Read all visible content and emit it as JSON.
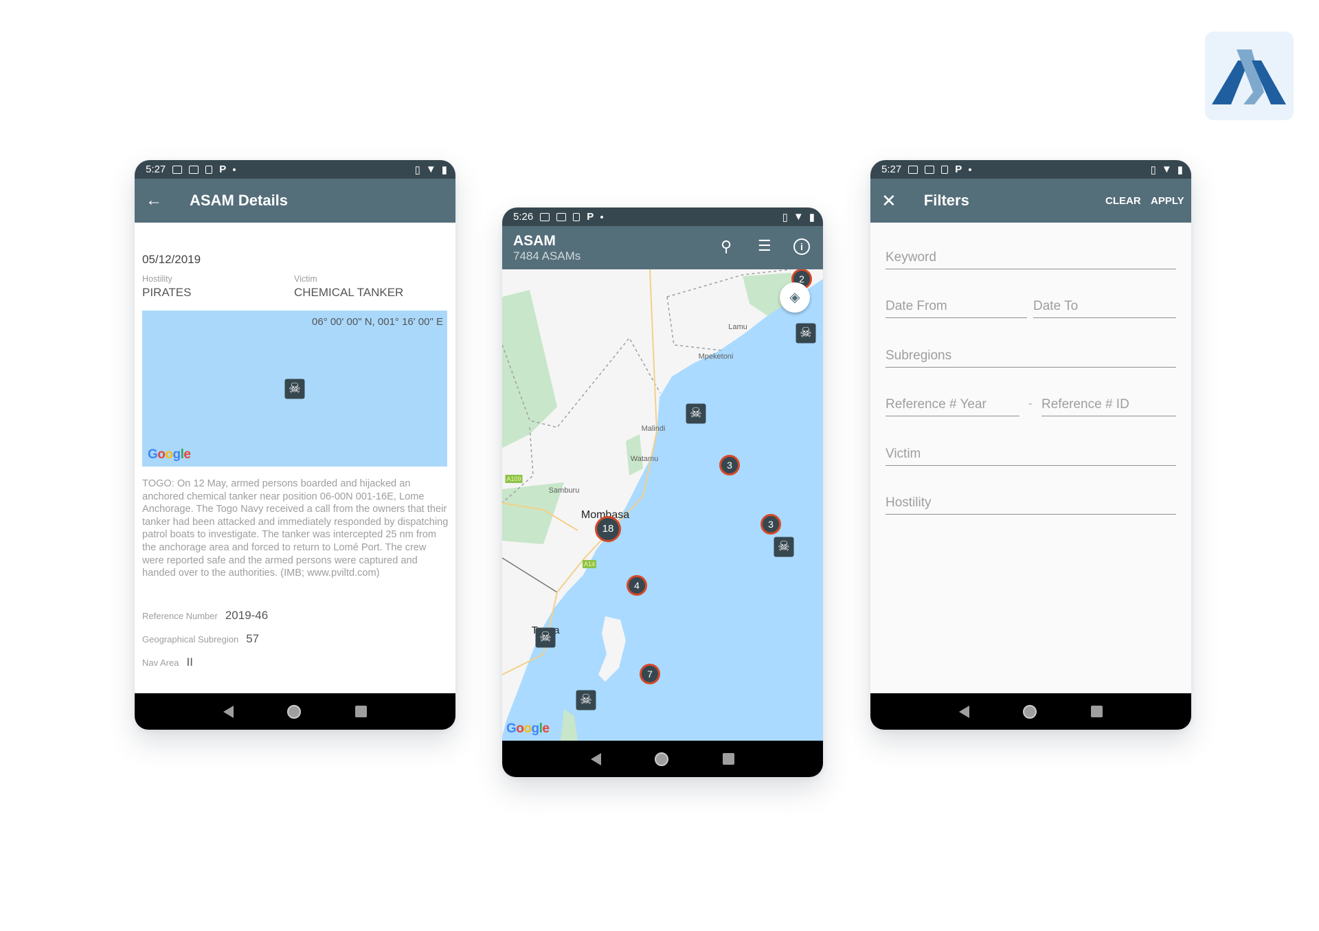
{
  "colors": {
    "status_bar": "#37474f",
    "app_bar": "#546e7a",
    "sea": "#aadaff",
    "land": "#f5f5f5",
    "park": "#c8e6c9",
    "marker": "#37474f",
    "cluster_ring": "#d5492a",
    "logo_dark": "#1f5fa0",
    "logo_light": "#7fa9cc"
  },
  "details": {
    "status": {
      "time": "5:27"
    },
    "title": "ASAM Details",
    "date": "05/12/2019",
    "hostility_label": "Hostility",
    "hostility": "PIRATES",
    "victim_label": "Victim",
    "victim": "CHEMICAL TANKER",
    "map": {
      "coordinates": "06° 00' 00\" N, 001° 16' 00\" E",
      "attribution": "Google"
    },
    "description": "TOGO: On 12 May, armed persons boarded and hijacked an anchored chemical tanker near position 06-00N 001-16E, Lome Anchorage. The Togo Navy received a call from the owners that their tanker had been attacked and immediately responded by dispatching patrol boats to investigate. The tanker was intercepted 25 nm from the anchorage  area and forced to return to Lomé Port. The crew were reported safe and the armed persons were captured and handed over to the authorities. (IMB; www.pviltd.com)",
    "fields": [
      {
        "label": "Reference Number",
        "value": "2019-46"
      },
      {
        "label": "Geographical Subregion",
        "value": "57"
      },
      {
        "label": "Nav Area",
        "value": "II"
      }
    ]
  },
  "map_screen": {
    "status": {
      "time": "5:26"
    },
    "title": "ASAM",
    "subtitle": "7484 ASAMs",
    "actions": [
      "search-icon",
      "list-icon",
      "info-icon"
    ],
    "clusters": [
      "2",
      "3",
      "3",
      "18",
      "4",
      "7"
    ],
    "places": [
      "Lamu",
      "Mpeketoni",
      "Malindi",
      "Watamu",
      "Samburu",
      "Mombasa",
      "Tanga"
    ],
    "roads": [
      "A109",
      "A14"
    ],
    "attribution": "Google"
  },
  "filters": {
    "status": {
      "time": "5:27"
    },
    "title": "Filters",
    "clear": "CLEAR",
    "apply": "APPLY",
    "keyword": "Keyword",
    "date_from": "Date From",
    "date_to": "Date To",
    "subregions": "Subregions",
    "ref_year": "Reference # Year",
    "ref_sep": "-",
    "ref_id": "Reference # ID",
    "victim": "Victim",
    "hostility": "Hostility"
  }
}
